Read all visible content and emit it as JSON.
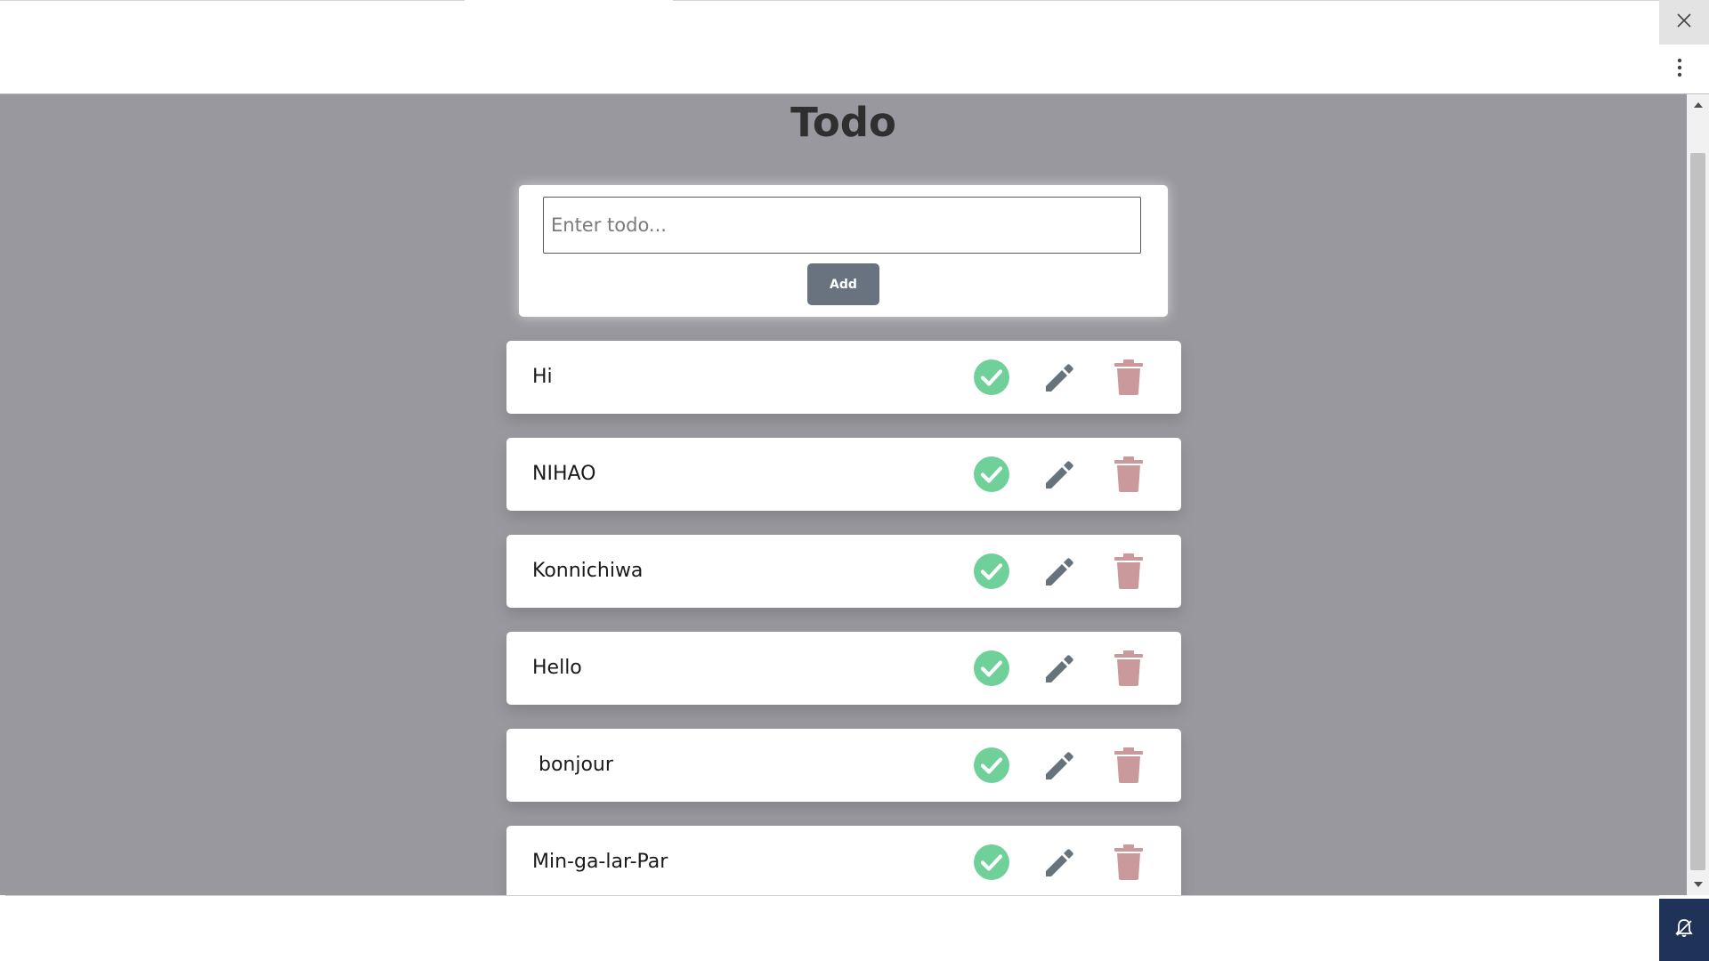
{
  "app": {
    "title": "Todo",
    "input_placeholder": "Enter todo...",
    "add_label": "Add"
  },
  "todos": [
    {
      "text": "Hi"
    },
    {
      "text": "NIHAO"
    },
    {
      "text": "Konnichiwa"
    },
    {
      "text": "Hello"
    },
    {
      "text": " bonjour"
    },
    {
      "text": "Min-ga-lar-Par"
    }
  ],
  "icons": {
    "complete": "check-circle-icon",
    "edit": "pencil-icon",
    "delete": "trash-icon",
    "close": "close-icon",
    "more": "more-vertical-icon",
    "notification": "bell-icon"
  },
  "colors": {
    "page_background": "#99989e",
    "check": "#6fd09a",
    "edit": "#67737a",
    "delete": "#c9999b",
    "add_button": "#68737f",
    "notification_button": "#1e3357"
  }
}
